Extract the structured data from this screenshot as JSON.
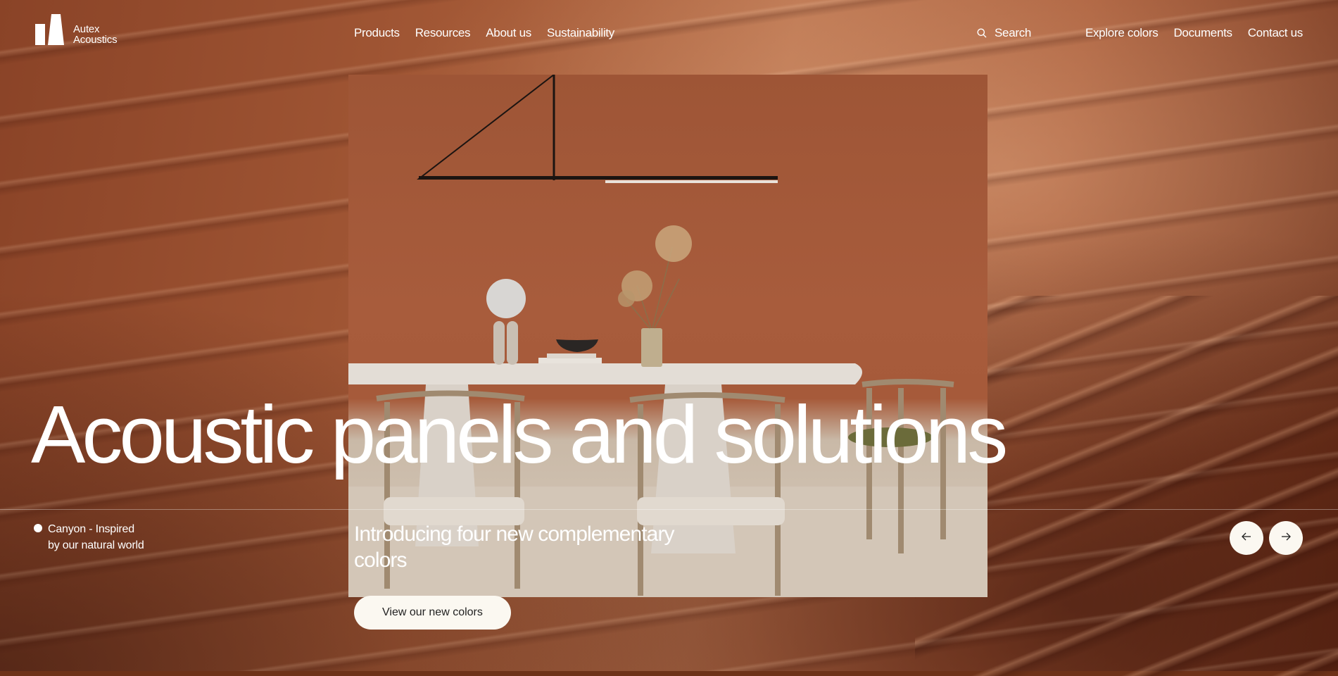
{
  "brand": {
    "name_line1": "Autex",
    "name_line2": "Acoustics"
  },
  "nav": {
    "main": [
      "Products",
      "Resources",
      "About us",
      "Sustainability"
    ],
    "search_label": "Search",
    "right": [
      "Explore colors",
      "Documents",
      "Contact us"
    ]
  },
  "hero": {
    "headline": "Acoustic panels and solutions",
    "slide_label": "Canyon - Inspired by our natural world",
    "intro": "Introducing four new complementary colors",
    "cta_label": "View our new colors"
  },
  "icons": {
    "logo": "autex-logo-icon",
    "search": "search-icon",
    "prev": "arrow-left-icon",
    "next": "arrow-right-icon"
  },
  "colors": {
    "background": "#a55a37",
    "button_bg": "#fbf8f1",
    "text": "#ffffff"
  }
}
